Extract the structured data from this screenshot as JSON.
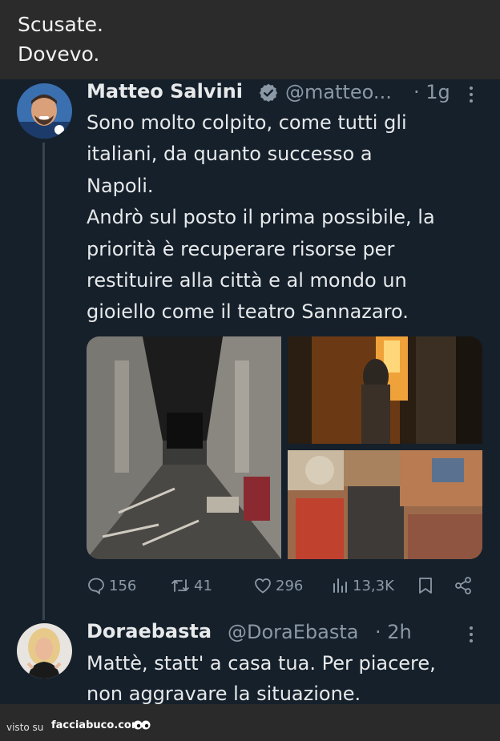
{
  "caption": {
    "line1": "Scusate.",
    "line2": "Dovevo."
  },
  "tweet": {
    "author_name": "Matteo Salvini",
    "verified": true,
    "handle": "@matteo...",
    "time": "· 1g",
    "text_lines": [
      "Sono molto colpito, come tutti gli",
      "italiani, da quanto successo a",
      "Napoli.",
      "Andrò sul posto il prima possibile, la",
      "priorità è recuperare risorse per",
      "restituire alla città e al mondo un",
      "gioiello come il teatro Sannazaro."
    ],
    "media_count": 3,
    "stats": {
      "replies": "156",
      "retweets": "41",
      "likes": "296",
      "views": "13,3K"
    }
  },
  "reply": {
    "author_name": "Doraebasta",
    "handle": "@DoraEbasta",
    "time": "· 2h",
    "text_lines": [
      "Mattè, statt' a casa tua. Per piacere,",
      "non aggravare la situazione."
    ]
  },
  "footer": {
    "visto": "visto su",
    "brand": "facciabuco.com"
  },
  "colors": {
    "background": "#15202b",
    "caption_bg": "#2b2b2b",
    "text": "#e7e9ea",
    "muted": "#8b98a5",
    "verified": "#1d9bf0"
  }
}
